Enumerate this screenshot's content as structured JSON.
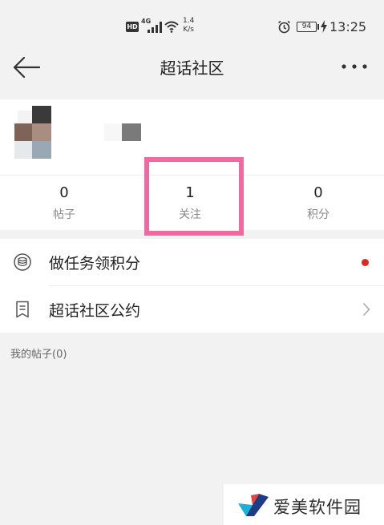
{
  "status_bar": {
    "hd": "HD",
    "network": "4G",
    "speed_value": "1.4",
    "speed_unit": "K/s",
    "battery": "94",
    "time": "13:25",
    "icons": [
      "signal-icon",
      "wifi-icon",
      "alarm-icon",
      "battery-icon",
      "charging-icon"
    ]
  },
  "header": {
    "title": "超话社区",
    "back_icon": "arrow-left-icon",
    "more_icon": "more-dots-icon"
  },
  "stats": [
    {
      "value": "0",
      "label": "帖子"
    },
    {
      "value": "1",
      "label": "关注"
    },
    {
      "value": "0",
      "label": "积分"
    }
  ],
  "menu": [
    {
      "label": "做任务领积分",
      "icon": "coins-icon",
      "badge": "red-dot"
    },
    {
      "label": "超话社区公约",
      "icon": "document-icon",
      "trailing": "chevron-right-icon"
    }
  ],
  "section": {
    "my_posts": "我的帖子(0)"
  },
  "watermark": {
    "text": "爱美软件园"
  },
  "colors": {
    "background": "#f2f2f2",
    "card": "#ffffff",
    "highlight_border": "#ef6aa0",
    "red_dot": "#e5261c"
  }
}
